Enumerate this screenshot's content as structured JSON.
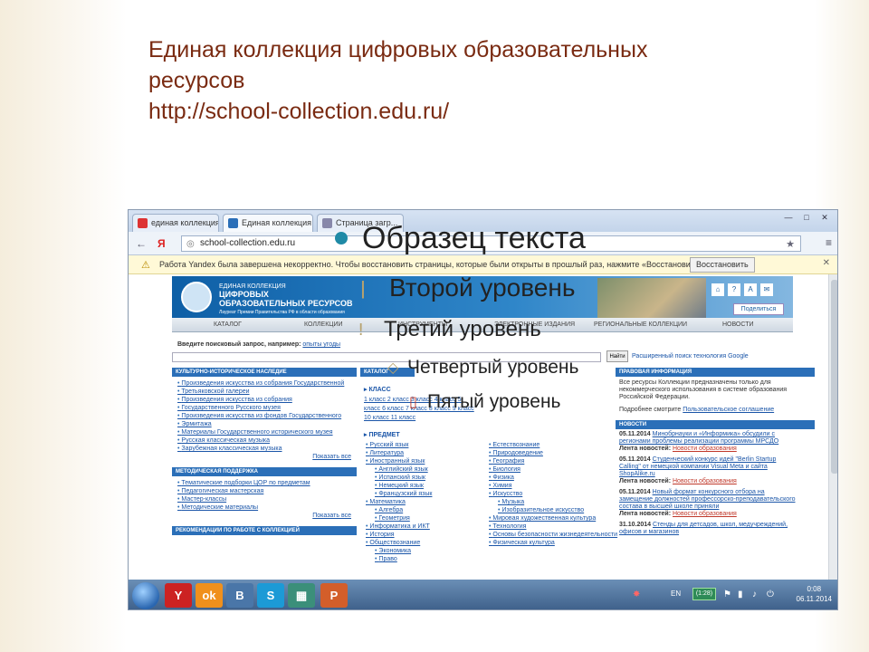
{
  "slide": {
    "title_lines": [
      "Единая коллекция цифровых образовательных",
      "ресурсов",
      "http://school-collection.edu.ru/"
    ]
  },
  "browser": {
    "tabs": [
      {
        "label": "единая коллекция ци",
        "active": false
      },
      {
        "label": "Единая коллекция Ци",
        "active": true
      },
      {
        "label": "Страница загр...",
        "active": false
      }
    ],
    "window_buttons": [
      "—",
      "□",
      "✕"
    ],
    "url": "school-collection.edu.ru",
    "nav_back": "←",
    "nav_yandex": "Я",
    "star_icon": "★",
    "menu_icon": "≡",
    "infobar_text": "Работа Yandex была завершена некорректно. Чтобы восстановить страницы, которые были открыты в прошлый раз, нажмите «Восстановить».",
    "infobar_button": "Восстановить",
    "infobar_close": "✕"
  },
  "site": {
    "header_title_1": "ЕДИНАЯ КОЛЛЕКЦИЯ",
    "header_title_2": "ЦИФРОВЫХ",
    "header_title_3": "ОБРАЗОВАТЕЛЬНЫХ РЕСУРСОВ",
    "header_sub": "Лауреат Премии Правительства РФ в области образования",
    "share": "Поделиться",
    "menu": [
      "КАТАЛОГ",
      "КОЛЛЕКЦИИ",
      "ИНСТРУМЕНТЫ",
      "ЭЛЕКТРОННЫЕ ИЗДАНИЯ",
      "РЕГИОНАЛЬНЫЕ КОЛЛЕКЦИИ",
      "НОВОСТИ"
    ],
    "search_label": "Введите поисковый запрос, например:",
    "search_example": "опыты угоды",
    "search_button": "Найти",
    "search_links": "Расширенный поиск   технология Google",
    "left_panels": [
      {
        "title": "КУЛЬТУРНО-ИСТОРИЧЕСКОЕ НАСЛЕДИЕ",
        "items": [
          "Произведения искусства из собрания Государственной",
          "Третьяковской галереи",
          "Произведения искусства из собрания",
          "Государственного Русского музея",
          "Произведения искусства из фондов Государственного",
          "Эрмитажа",
          "Материалы Государственного исторического музея",
          "Русская классическая музыка",
          "Зарубежная классическая музыка"
        ],
        "more": "Показать все"
      },
      {
        "title": "МЕТОДИЧЕСКАЯ ПОДДЕРЖКА",
        "items": [
          "Тематические подборки ЦОР по предметам",
          "Педагогическая мастерская",
          "Мастер-классы",
          "Методические материалы"
        ],
        "more": "Показать все"
      },
      {
        "title": "РЕКОМЕНДАЦИИ ПО РАБОТЕ С КОЛЛЕКЦИЕЙ",
        "items": [],
        "more": ""
      }
    ],
    "catalog_title": "КАТАЛОГ",
    "class_title": "КЛАСС",
    "grades": "1 класс  2 класс  3 класс  4 класс  5 класс  6 класс  7 класс  8 класс  9 класс  10 класс  11 класс",
    "subject_title": "ПРЕДМЕТ",
    "subjects_left": [
      "Русский язык",
      "Литература",
      "Иностранный язык",
      "Английский язык",
      "Испанский язык",
      "Немецкий язык",
      "Французский язык",
      "Математика",
      "Алгебра",
      "Геометрия",
      "Информатика и ИКТ",
      "История",
      "Обществознание",
      "Экономика",
      "Право"
    ],
    "subjects_right": [
      "Естествознание",
      "Природоведение",
      "География",
      "Биология",
      "Физика",
      "Химия",
      "Искусство",
      "Музыка",
      "Изобразительное искусство",
      "Мировая художественная культура",
      "Технология",
      "Основы безопасности жизнедеятельности",
      "Физическая культура"
    ],
    "rights_title": "ПРАВОВАЯ ИНФОРМАЦИЯ",
    "rights_text": "Все ресурсы Коллекции предназначены только для некоммерческого использования в системе образования Российской Федерации.",
    "rights_link_prefix": "Подробнее смотрите",
    "rights_link": "Пользовательское соглашение",
    "news_title": "НОВОСТИ",
    "news": [
      {
        "date": "05.11.2014",
        "text": "Минобрнауки и «Информика» обсудили с регионами проблемы реализации программы МРСДО",
        "source": "Лента новостей:",
        "tag": "Новости образования"
      },
      {
        "date": "05.11.2014",
        "text": "Студенческий конкурс идей \"Berlin Startup Calling\" от немецкой компании Visual Meta и сайта ShopAlike.ru",
        "source": "Лента новостей:",
        "tag": "Новости образования"
      },
      {
        "date": "05.11.2014",
        "text": "Новый формат конкурсного отбора на замещение должностей профессорско-преподавательского состава в высшей школе приняли",
        "source": "Лента новостей:",
        "tag": "Новости образования"
      },
      {
        "date": "31.10.2014",
        "text": "Стенды для детсадов, школ, медучреждений, офисов и магазинов",
        "source": "",
        "tag": ""
      }
    ]
  },
  "taskbar": {
    "lang": "EN",
    "battery": "(1:28)",
    "time": "0:08",
    "date": "06.11.2014"
  },
  "overlay": {
    "level1": "Образец текста",
    "level2": "Второй уровень",
    "level3": "Третий уровень",
    "level4": "Четвертый уровень",
    "level5": "Пятый уровень",
    "colors": {
      "bullet": "#1f8aa6",
      "title": "#7a2b12"
    }
  }
}
